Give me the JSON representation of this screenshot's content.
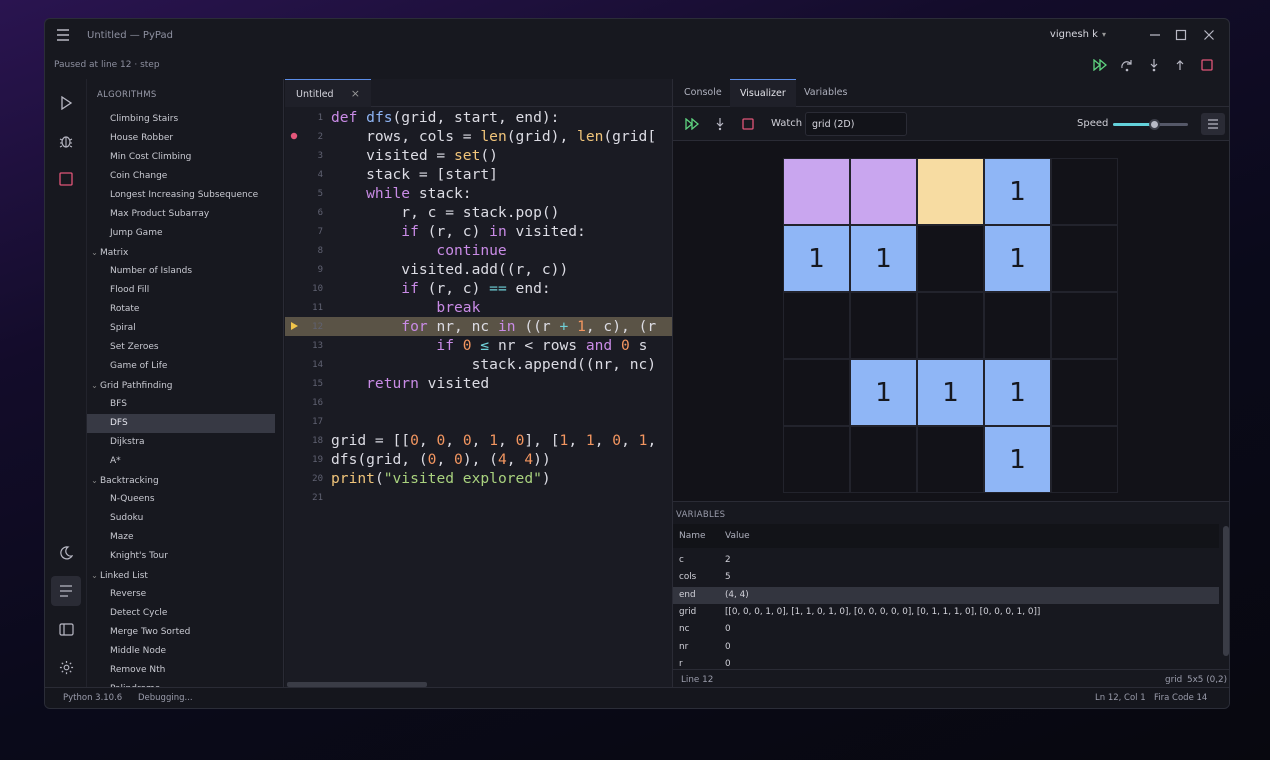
{
  "window": {
    "title": "Untitled — PyPad",
    "user": "vignesh k"
  },
  "debug": {
    "status": "Paused at line 12  ·  step"
  },
  "sidebar": {
    "header": "ALGORITHMS",
    "items": [
      {
        "type": "leaf",
        "label": "Climbing Stairs"
      },
      {
        "type": "leaf",
        "label": "House Robber"
      },
      {
        "type": "leaf",
        "label": "Min Cost Climbing"
      },
      {
        "type": "leaf",
        "label": "Coin Change"
      },
      {
        "type": "leaf",
        "label": "Longest Increasing Subsequence"
      },
      {
        "type": "leaf",
        "label": "Max Product Subarray"
      },
      {
        "type": "leaf",
        "label": "Jump Game"
      },
      {
        "type": "group",
        "label": "Matrix"
      },
      {
        "type": "leaf",
        "label": "Number of Islands"
      },
      {
        "type": "leaf",
        "label": "Flood Fill"
      },
      {
        "type": "leaf",
        "label": "Rotate"
      },
      {
        "type": "leaf",
        "label": "Spiral"
      },
      {
        "type": "leaf",
        "label": "Set Zeroes"
      },
      {
        "type": "leaf",
        "label": "Game of Life"
      },
      {
        "type": "group",
        "label": "Grid Pathfinding"
      },
      {
        "type": "leaf",
        "label": "BFS"
      },
      {
        "type": "leaf",
        "label": "DFS",
        "selected": true
      },
      {
        "type": "leaf",
        "label": "Dijkstra"
      },
      {
        "type": "leaf",
        "label": "A*"
      },
      {
        "type": "group",
        "label": "Backtracking"
      },
      {
        "type": "leaf",
        "label": "N-Queens"
      },
      {
        "type": "leaf",
        "label": "Sudoku"
      },
      {
        "type": "leaf",
        "label": "Maze"
      },
      {
        "type": "leaf",
        "label": "Knight's Tour"
      },
      {
        "type": "group",
        "label": "Linked List"
      },
      {
        "type": "leaf",
        "label": "Reverse"
      },
      {
        "type": "leaf",
        "label": "Detect Cycle"
      },
      {
        "type": "leaf",
        "label": "Merge Two Sorted"
      },
      {
        "type": "leaf",
        "label": "Middle Node"
      },
      {
        "type": "leaf",
        "label": "Remove Nth"
      },
      {
        "type": "leaf",
        "label": "Palindrome"
      }
    ]
  },
  "editor": {
    "tab": "Untitled",
    "breakpoint_line": 2,
    "current_line": 12,
    "lines": [
      [
        [
          "kw",
          "def "
        ],
        [
          "fn",
          "dfs"
        ],
        [
          "",
          "(grid, start, end):"
        ]
      ],
      [
        [
          "",
          "    rows, cols = "
        ],
        [
          "bi",
          "len"
        ],
        [
          "",
          "(grid), "
        ],
        [
          "bi",
          "len"
        ],
        [
          "",
          "(grid["
        ]
      ],
      [
        [
          "",
          "    visited = "
        ],
        [
          "bi",
          "set"
        ],
        [
          "",
          "()"
        ]
      ],
      [
        [
          "",
          "    stack = [start]"
        ]
      ],
      [
        [
          "kw",
          "    while "
        ],
        [
          "",
          "stack:"
        ]
      ],
      [
        [
          "",
          "        r, c = stack.pop()"
        ]
      ],
      [
        [
          "kw",
          "        if "
        ],
        [
          "",
          "(r, c) "
        ],
        [
          "kw",
          "in "
        ],
        [
          "",
          "visited:"
        ]
      ],
      [
        [
          "kw",
          "            continue"
        ]
      ],
      [
        [
          "",
          "        visited.add((r, c))"
        ]
      ],
      [
        [
          "kw",
          "        if "
        ],
        [
          "",
          "(r, c) "
        ],
        [
          "op",
          "=="
        ],
        [
          "",
          " end:"
        ]
      ],
      [
        [
          "kw",
          "            break"
        ]
      ],
      [
        [
          "kw",
          "        for "
        ],
        [
          "",
          "nr, nc "
        ],
        [
          "kw",
          "in "
        ],
        [
          "",
          "((r "
        ],
        [
          "op",
          "+"
        ],
        [
          "",
          " "
        ],
        [
          "nm",
          "1"
        ],
        [
          "",
          ", c), (r"
        ]
      ],
      [
        [
          "kw",
          "            if "
        ],
        [
          "nm",
          "0"
        ],
        [
          "",
          " "
        ],
        [
          "op",
          "≤"
        ],
        [
          "",
          " nr < rows "
        ],
        [
          "kw",
          "and "
        ],
        [
          "nm",
          "0"
        ],
        [
          "",
          " s"
        ]
      ],
      [
        [
          "",
          "                stack.append((nr, nc)"
        ]
      ],
      [
        [
          "kw",
          "    return "
        ],
        [
          "",
          "visited"
        ]
      ],
      [],
      [],
      [
        [
          "",
          "grid = [["
        ],
        [
          "nm",
          "0"
        ],
        [
          "",
          ", "
        ],
        [
          "nm",
          "0"
        ],
        [
          "",
          ", "
        ],
        [
          "nm",
          "0"
        ],
        [
          "",
          ", "
        ],
        [
          "nm",
          "1"
        ],
        [
          "",
          ", "
        ],
        [
          "nm",
          "0"
        ],
        [
          "",
          "], ["
        ],
        [
          "nm",
          "1"
        ],
        [
          "",
          ", "
        ],
        [
          "nm",
          "1"
        ],
        [
          "",
          ", "
        ],
        [
          "nm",
          "0"
        ],
        [
          "",
          ", "
        ],
        [
          "nm",
          "1"
        ],
        [
          "",
          ","
        ]
      ],
      [
        [
          "",
          "dfs(grid, ("
        ],
        [
          "nm",
          "0"
        ],
        [
          "",
          ", "
        ],
        [
          "nm",
          "0"
        ],
        [
          "",
          "), ("
        ],
        [
          "nm",
          "4"
        ],
        [
          "",
          ", "
        ],
        [
          "nm",
          "4"
        ],
        [
          "",
          "))"
        ]
      ],
      [
        [
          "bi",
          "print"
        ],
        [
          "",
          "("
        ],
        [
          "st",
          "\"visited explored\""
        ],
        [
          "",
          ")"
        ]
      ],
      []
    ]
  },
  "right": {
    "tabs": [
      "Console",
      "Visualizer",
      "Variables"
    ],
    "selected_tab": "Visualizer",
    "watch_label": "Watch",
    "watch_value": "grid  (2D)",
    "speed_label": "Speed",
    "speed_value": 0.55,
    "grid": {
      "cells": [
        [
          "visited",
          "visited",
          "current",
          "1",
          ""
        ],
        [
          "1",
          "1",
          "",
          "1",
          ""
        ],
        [
          "",
          "",
          "",
          "",
          ""
        ],
        [
          "",
          "1",
          "1",
          "1",
          ""
        ],
        [
          "",
          "",
          "",
          "1",
          ""
        ]
      ],
      "colors": {
        "visited": "#c9a6ef",
        "current": "#f7dca2",
        "wall": "#8fb6f6",
        "empty": "#121218"
      }
    },
    "variables": {
      "header": "VARIABLES",
      "col_name": "Name",
      "col_value": "Value",
      "rows": [
        {
          "name": "c",
          "value": "2"
        },
        {
          "name": "cols",
          "value": "5"
        },
        {
          "name": "end",
          "value": "(4, 4)",
          "selected": true
        },
        {
          "name": "grid",
          "value": "[[0, 0, 0, 1, 0], [1, 1, 0, 1, 0], [0, 0, 0, 0, 0], [0, 1, 1, 1, 0], [0, 0, 0, 1, 0]]"
        },
        {
          "name": "nc",
          "value": "0"
        },
        {
          "name": "nr",
          "value": "0"
        },
        {
          "name": "r",
          "value": "0"
        }
      ]
    },
    "status": {
      "line": "Line 12",
      "grid_name": "grid",
      "grid_info": "5x5  (0,2)"
    }
  },
  "statusbar": {
    "python": "Python 3.10.6",
    "state": "Debugging...",
    "cursor": "Ln 12, Col 1",
    "font": "Fira Code  14"
  }
}
